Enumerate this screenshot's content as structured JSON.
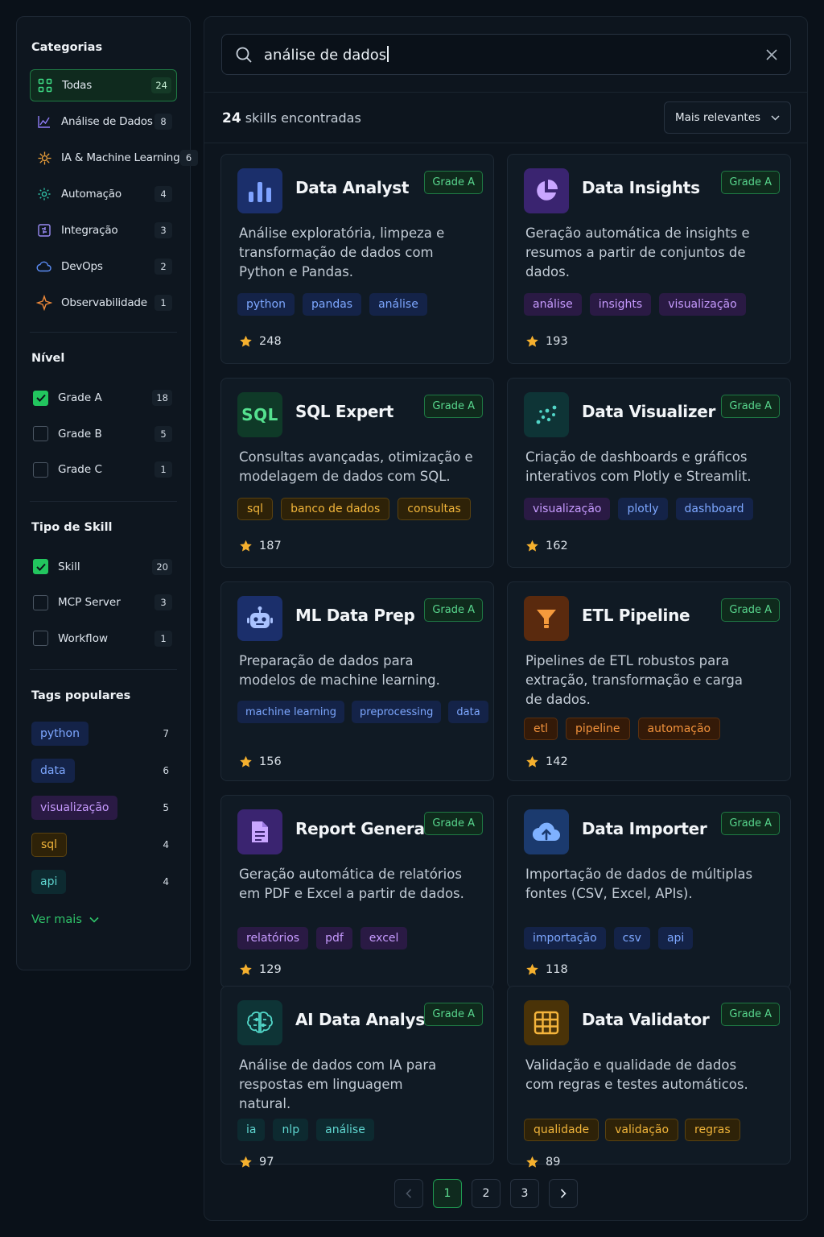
{
  "sidebar": {
    "categories_title": "Categorias",
    "categories": [
      {
        "label": "Todas",
        "count": "24",
        "icon": "grid-icon"
      },
      {
        "label": "Análise de Dados",
        "count": "8",
        "icon": "line-chart-icon"
      },
      {
        "label": "IA & Machine Learning",
        "count": "6",
        "icon": "brain-icon"
      },
      {
        "label": "Automação",
        "count": "4",
        "icon": "gear-icon"
      },
      {
        "label": "Integração",
        "count": "3",
        "icon": "integration-icon"
      },
      {
        "label": "DevOps",
        "count": "2",
        "icon": "cloud-icon"
      },
      {
        "label": "Observabilidade",
        "count": "1",
        "icon": "pulse-icon"
      }
    ],
    "level_title": "Nível",
    "levels": [
      {
        "label": "Grade A",
        "count": "18",
        "checked": true
      },
      {
        "label": "Grade B",
        "count": "5",
        "checked": false
      },
      {
        "label": "Grade C",
        "count": "1",
        "checked": false
      }
    ],
    "type_title": "Tipo de Skill",
    "types": [
      {
        "label": "Skill",
        "count": "20",
        "checked": true
      },
      {
        "label": "MCP Server",
        "count": "3",
        "checked": false
      },
      {
        "label": "Workflow",
        "count": "1",
        "checked": false
      }
    ],
    "tags_title": "Tags populares",
    "tags": [
      {
        "label": "python",
        "count": "7",
        "color": "blue"
      },
      {
        "label": "data",
        "count": "6",
        "color": "blue"
      },
      {
        "label": "visualização",
        "count": "5",
        "color": "purple"
      },
      {
        "label": "sql",
        "count": "4",
        "color": "amber"
      },
      {
        "label": "api",
        "count": "4",
        "color": "teal"
      }
    ],
    "see_more": "Ver mais"
  },
  "search": {
    "value": "análise de dados"
  },
  "results": {
    "count": "24",
    "label": "skills encontradas"
  },
  "sort": {
    "selected": "Mais relevantes"
  },
  "cards": [
    {
      "title": "Data Analyst",
      "grade": "Grade A",
      "desc": "Análise exploratória, limpeza e transformação de dados com Python e Pandas.",
      "tags": [
        "python",
        "pandas",
        "análise"
      ],
      "tag_color": "blue",
      "rating": "248",
      "icon": "bar-chart-icon"
    },
    {
      "title": "Data Insights",
      "grade": "Grade A",
      "desc": "Geração automática de insights e resumos a partir de conjuntos de dados.",
      "tags": [
        "análise",
        "insights",
        "visualização"
      ],
      "tag_color": "purple",
      "rating": "193",
      "icon": "pie-chart-icon"
    },
    {
      "title": "SQL Expert",
      "grade": "Grade A",
      "desc": "Consultas avançadas, otimização e modelagem de dados com SQL.",
      "tags": [
        "sql",
        "banco de dados",
        "consultas"
      ],
      "tag_color": "amber",
      "rating": "187",
      "icon": "sql-icon",
      "icon_text": "SQL"
    },
    {
      "title": "Data Visualizer",
      "grade": "Grade A",
      "desc": "Criação de dashboards e gráficos interativos com Plotly e Streamlit.",
      "tags": [
        "visualização",
        "plotly",
        "dashboard"
      ],
      "tag_color": "purple",
      "rating": "162",
      "icon": "scatter-icon"
    },
    {
      "title": "ML Data Prep",
      "grade": "Grade A",
      "desc": "Preparação de dados para modelos de machine learning.",
      "tags": [
        "machine learning",
        "preprocessing",
        "data"
      ],
      "tag_color": "blue",
      "rating": "156",
      "icon": "robot-icon"
    },
    {
      "title": "ETL Pipeline",
      "grade": "Grade A",
      "desc": "Pipelines de ETL robustos para extração, transformação e carga de dados.",
      "tags": [
        "etl",
        "pipeline",
        "automação"
      ],
      "tag_color": "orange",
      "rating": "142",
      "icon": "funnel-icon"
    },
    {
      "title": "Report Generator",
      "grade": "Grade A",
      "desc": "Geração automática de relatórios em PDF e Excel a partir de dados.",
      "tags": [
        "relatórios",
        "pdf",
        "excel"
      ],
      "tag_color": "purple",
      "rating": "129",
      "icon": "document-icon"
    },
    {
      "title": "Data Importer",
      "grade": "Grade A",
      "desc": "Importação de dados de múltiplas fontes (CSV, Excel, APIs).",
      "tags": [
        "importação",
        "csv",
        "api"
      ],
      "tag_color": "blue",
      "rating": "118",
      "icon": "cloud-upload-icon"
    },
    {
      "title": "AI Data Analyst",
      "grade": "Grade A",
      "desc": "Análise de dados com IA para respostas em linguagem natural.",
      "tags": [
        "ia",
        "nlp",
        "análise"
      ],
      "tag_color": "teal",
      "rating": "97",
      "icon": "brain-icon"
    },
    {
      "title": "Data Validator",
      "grade": "Grade A",
      "desc": "Validação e qualidade de dados com regras e testes automáticos.",
      "tags": [
        "qualidade",
        "validação",
        "regras"
      ],
      "tag_color": "amber",
      "rating": "89",
      "icon": "table-icon"
    }
  ],
  "pagination": {
    "pages": [
      "1",
      "2",
      "3"
    ],
    "current": "1"
  },
  "colors": {
    "accent": "#22c55e",
    "background": "#0a1119",
    "star": "#f5b02e"
  }
}
